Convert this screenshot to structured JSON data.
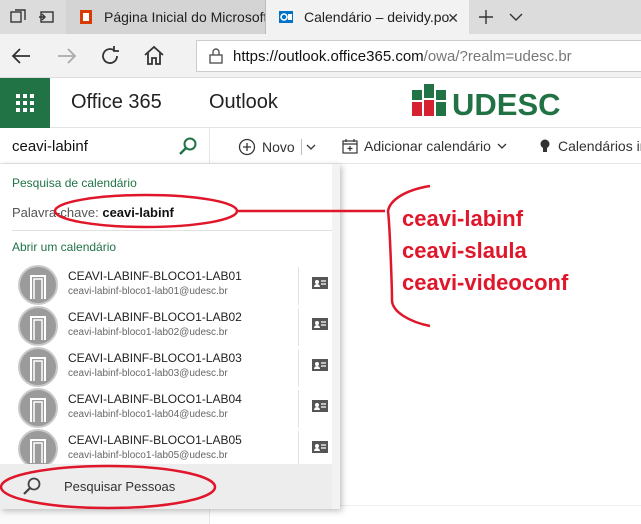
{
  "browser": {
    "tabs": [
      {
        "label": "Página Inicial do Microsoft",
        "favicon": "office-icon",
        "color": "#d83b01"
      },
      {
        "label": "Calendário – deividy.po",
        "favicon": "outlook-icon",
        "color": "#0072c6"
      }
    ],
    "url_main": "https://outlook.office365.com",
    "url_rest": "/owa/?realm=udesc.br"
  },
  "header": {
    "product": "Office 365",
    "app": "Outlook",
    "logo_text": "UDESC",
    "accent": "#217346"
  },
  "search": {
    "value": "ceavi-labinf"
  },
  "commands": {
    "new_label": "Novo",
    "add_calendar_label": "Adicionar calendário",
    "calendars_label": "Calendários in"
  },
  "dropdown": {
    "section_search": "Pesquisa de calendário",
    "keyword_label": "Palavra-chave:",
    "keyword_value": "ceavi-labinf",
    "section_open": "Abrir um calendário",
    "results": [
      {
        "name": "CEAVI-LABINF-BLOCO1-LAB01",
        "email": "ceavi-labinf-bloco1-lab01@udesc.br"
      },
      {
        "name": "CEAVI-LABINF-BLOCO1-LAB02",
        "email": "ceavi-labinf-bloco1-lab02@udesc.br"
      },
      {
        "name": "CEAVI-LABINF-BLOCO1-LAB03",
        "email": "ceavi-labinf-bloco1-lab03@udesc.br"
      },
      {
        "name": "CEAVI-LABINF-BLOCO1-LAB04",
        "email": "ceavi-labinf-bloco1-lab04@udesc.br"
      },
      {
        "name": "CEAVI-LABINF-BLOCO1-LAB05",
        "email": "ceavi-labinf-bloco1-lab05@udesc.br"
      }
    ],
    "people_search": "Pesquisar Pessoas"
  },
  "annotation": {
    "color": "#e0162b",
    "lines": [
      "ceavi-labinf",
      "ceavi-slaula",
      "ceavi-videoconf"
    ]
  }
}
